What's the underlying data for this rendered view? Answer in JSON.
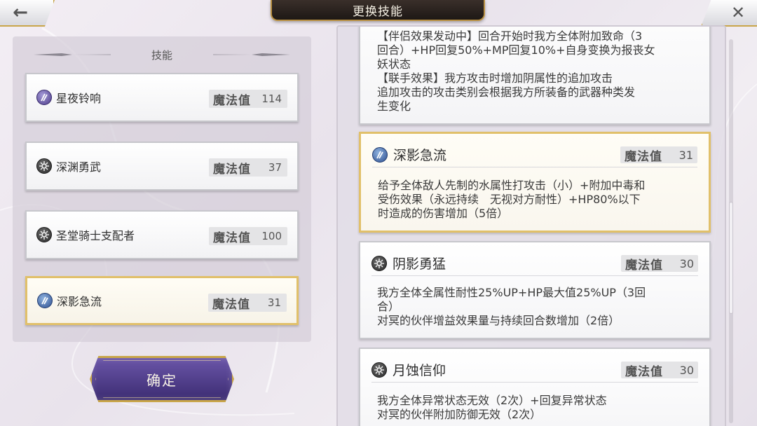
{
  "header": {
    "title": "更换技能",
    "back_icon": "←",
    "close_icon": "✕"
  },
  "left": {
    "section_title": "技能",
    "slots": [
      {
        "name": "星夜铃响",
        "mp_label": "魔法值",
        "mp_value": "114",
        "icon": "magic-icon",
        "selected": false
      },
      {
        "name": "深渊勇武",
        "mp_label": "魔法值",
        "mp_value": "37",
        "icon": "gear-icon",
        "selected": false
      },
      {
        "name": "圣堂骑士支配者",
        "mp_label": "魔法值",
        "mp_value": "100",
        "icon": "gear-icon",
        "selected": false
      },
      {
        "name": "深影急流",
        "mp_label": "魔法值",
        "mp_value": "31",
        "icon": "magic-icon",
        "selected": true
      }
    ],
    "confirm_label": "确定"
  },
  "right": {
    "cards": [
      {
        "name": "",
        "mp_label": "",
        "mp_value": "",
        "desc": "【伴侣效果发动中】回合开始时我方全体附加致命（3\n回合）+HP回复50%+MP回复10%+自身变换为报丧女\n妖状态\n【联手效果】我方攻击时增加阴属性的追加攻击\n追加攻击的攻击类别会根据我方所装备的武器种类发\n生变化"
      },
      {
        "name": "深影急流",
        "mp_label": "魔法值",
        "mp_value": "31",
        "icon": "magic-icon",
        "selected": true,
        "desc": "给予全体敌人先制的水属性打攻击（小）+附加中毒和\n受伤效果（永远持续　无视对方耐性）+HP80%以下\n时造成的伤害增加（5倍）"
      },
      {
        "name": "阴影勇猛",
        "mp_label": "魔法值",
        "mp_value": "30",
        "icon": "gear-icon",
        "selected": false,
        "desc": "我方全体全属性耐性25%UP+HP最大值25%UP（3回\n合）\n对冥的伙伴增益效果量与持续回合数增加（2倍）"
      },
      {
        "name": "月蚀信仰",
        "mp_label": "魔法值",
        "mp_value": "30",
        "icon": "gear-icon",
        "selected": false,
        "desc": "我方全体异常状态无效（2次）+回复异常状态\n对冥的伙伴附加防御无效（2次）"
      }
    ]
  }
}
